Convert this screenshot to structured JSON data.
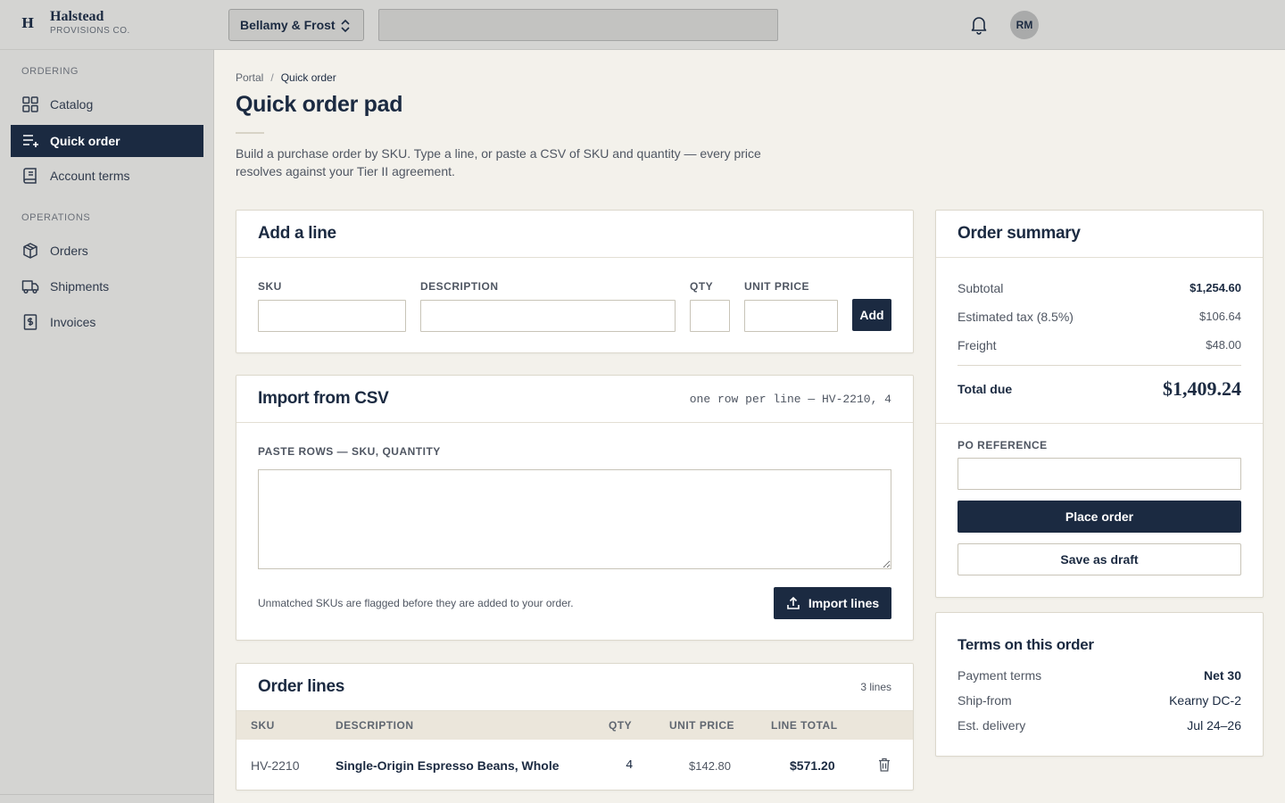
{
  "brand": {
    "mark": "H",
    "name": "Halstead",
    "sub": "PROVISIONS CO."
  },
  "topbar": {
    "account": "Bellamy & Frost",
    "search_value": "",
    "avatar_initials": "RM"
  },
  "sidebar": {
    "section_ordering": "ORDERING",
    "section_operations": "OPERATIONS",
    "items": [
      {
        "label": "Catalog",
        "icon": "grid-icon"
      },
      {
        "label": "Quick order",
        "icon": "list-add-icon",
        "active": true
      },
      {
        "label": "Account terms",
        "icon": "ledger-icon"
      },
      {
        "label": "Orders",
        "icon": "box-icon"
      },
      {
        "label": "Shipments",
        "icon": "truck-icon"
      },
      {
        "label": "Invoices",
        "icon": "invoice-icon"
      }
    ]
  },
  "breadcrumb": {
    "root": "Portal",
    "sep": "/",
    "current": "Quick order"
  },
  "page": {
    "title": "Quick order pad",
    "intro": "Build a purchase order by SKU. Type a line, or paste a CSV of SKU and quantity — every price resolves against your Tier II agreement."
  },
  "add_line": {
    "title": "Add a line",
    "sku_label": "SKU",
    "desc_label": "DESCRIPTION",
    "qty_label": "QTY",
    "price_label": "UNIT PRICE",
    "sku_value": "",
    "desc_value": "",
    "qty_value": "",
    "price_value": "",
    "add_button": "Add"
  },
  "import_csv": {
    "title": "Import from CSV",
    "hint": "one row per line — HV-2210, 4",
    "paste_label": "PASTE ROWS — SKU, QUANTITY",
    "paste_value": "",
    "note": "Unmatched SKUs are flagged before they are added to your order.",
    "import_button": "Import lines"
  },
  "order_lines": {
    "title": "Order lines",
    "count": "3 lines",
    "columns": [
      "SKU",
      "DESCRIPTION",
      "QTY",
      "UNIT PRICE",
      "LINE TOTAL"
    ],
    "rows": [
      {
        "sku": "HV-2210",
        "description": "Single-Origin Espresso Beans, Whole",
        "qty": "4",
        "unit_price": "$142.80",
        "line_total": "$571.20"
      }
    ]
  },
  "summary": {
    "title": "Order summary",
    "subtotal_label": "Subtotal",
    "subtotal": "$1,254.60",
    "tax_label": "Estimated tax (8.5%)",
    "tax": "$106.64",
    "freight_label": "Freight",
    "freight": "$48.00",
    "total_label": "Total due",
    "total": "$1,409.24",
    "po_label": "PO REFERENCE",
    "po_value": "",
    "place_button": "Place order",
    "draft_button": "Save as draft"
  },
  "terms": {
    "title": "Terms on this order",
    "payment_label": "Payment terms",
    "payment": "Net 30",
    "shipfrom_label": "Ship-from",
    "shipfrom": "Kearny DC-2",
    "delivery_label": "Est. delivery",
    "delivery": "Jul 24–26"
  },
  "colors": {
    "navy": "#1b2a41",
    "page_bg": "#f3f1eb",
    "chrome": "#d4d4d2"
  }
}
